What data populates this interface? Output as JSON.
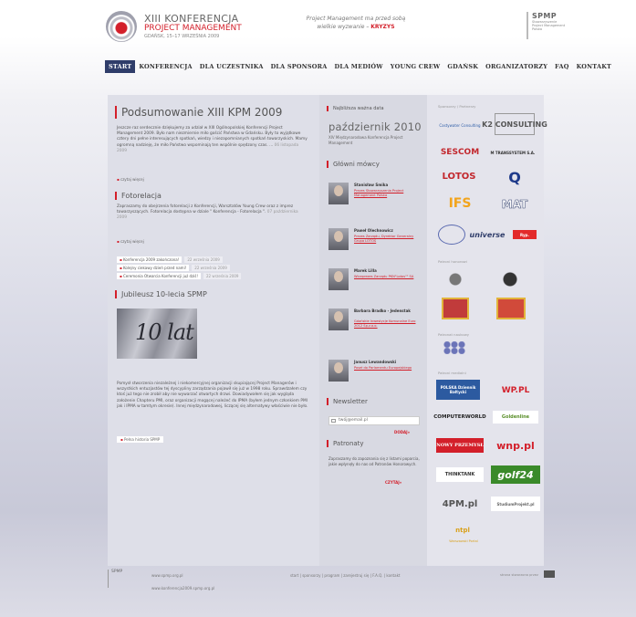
{
  "header": {
    "logo_line1": "XIII KONFERENCJA",
    "logo_line2": "PROJECT MANAGEMENT",
    "logo_line3": "GDAŃSK, 15–17 WRZEŚNIA 2009",
    "tagline_1": "Project Management ma przed sobą",
    "tagline_2": "wielkie wyzwanie –",
    "tagline_hl": "KRYZYS",
    "spmp_title": "SPMP",
    "spmp_sub": "Stowarzyszenie Project Management Polska"
  },
  "nav": {
    "items": [
      "START",
      "KONFERENCJA",
      "DLA UCZESTNIKA",
      "DLA SPONSORA",
      "DLA MEDIÓW",
      "YOUNG CREW",
      "GDAŃSK",
      "ORGANIZATORZY",
      "FAQ",
      "KONTAKT"
    ]
  },
  "main": {
    "title": "Podsumowanie XIII KPM 2009",
    "intro": "Jeszcze raz serdecznie dziękujemy za udział w XIII Ogólnopolskiej Konferencji Project Management 2009. Było nam niezmiernie miło gościć Państwa w Gdańsku. Były to wyjątkowe cztery dni pełne interesujących spotkań, wiedzy i niezapomnianych spotkań towarzyskich. Mamy ogromną nadzieję, że miło Państwo wspominają ten wspólnie spędzony czas. ...",
    "intro_date": "06 listopada 2009",
    "more_1": "czytaj więcej",
    "gallery_title": "Fotorelacja",
    "gallery_text": "Zapraszamy do obejrzenia fotorelacji z Konferencji, Warsztatów Young Crew oraz z imprez towarzyszących. Fotorelacja dostępna w dziale \" Konferencja - Fotorelacja \".",
    "gallery_date": "07 października 2009",
    "more_2": "czytaj więcej",
    "news": [
      {
        "label": "Konferencja 2009 zakończona!",
        "date": "22 września 2009"
      },
      {
        "label": "Kolejny ciekawy dzień przed nami!",
        "date": "22 września 2009"
      },
      {
        "label": "Ceremonia Otwarcia Konferencji już dziś!",
        "date": "22 września 2009"
      }
    ],
    "jubilee_title": "Jubileusz 10-lecia SPMP",
    "jubilee_photo_text": "10 lat",
    "jubilee_text": "Pomysł stworzenia niezależnej i niekomercyjnej organizacji skupiającej Project Managerów i wszystkich entuzjastów tej dyscypliny zarządzania pojawił się już w 1998 roku. Sprawdzałem czy ktoś już tego nie zrobił aby nie wywarzać otwartych drzwi. Dowiadywałem się jak wygląda założenie Chapteru PMI, oraz organizacji mogącej należeć do IPMA (byłem jednym członkiem PMI jak i IPMA w tamtym okresie). Innej międzynarodowej, liczącej się alternatywy właściwie nie było.",
    "jubilee_more": "Pełna historia SPMP"
  },
  "middle": {
    "next_label": "Najbliższa ważna data",
    "next_date": "październik 2010",
    "next_sub": "XIV Międzynarodowa Konferencja Project Management",
    "speakers_title": "Główni mówcy",
    "speakers": [
      {
        "name": "Stanisław Smika",
        "role": "Prezes Stowarzyszenia Project Management Polska"
      },
      {
        "name": "Paweł Olechnowicz",
        "role": "Prezes Zarządu, Dyrektor Generalny Grupa LOTOS"
      },
      {
        "name": "Marek Lilla",
        "role": "Wiceprezes Zarządu PKN\"Lotos\"\" SA"
      },
      {
        "name": "Barbara Bradko - Jedenstak",
        "role": "Gdańskie Inwestycje Komunalne Euro 2012 Sp.z.o.o."
      },
      {
        "name": "Janusz Lewandowski",
        "role": "Poseł do Parlamentu Europejskiego"
      }
    ],
    "newsletter_title": "Newsletter",
    "newsletter_placeholder": "twój@email.pl",
    "newsletter_button": "DODAJ»",
    "patrons_title": "Patronaty",
    "patrons_text": "Zapraszamy do zapoznania się z listami poparcia, jakie wpłynęły do nas od Patronów Honorowych.",
    "patrons_button": "CZYTAJ»"
  },
  "sponsors": {
    "sec_sponsors": "Sponsorzy / Partnerzy",
    "sec_honor": "Patroni honorowi",
    "sec_science": "Patronat naukowy",
    "sec_media": "Patroni medialni",
    "logos": [
      "Castywater Consulting",
      "K2 CONSULTING",
      "SESCOM",
      "M TRANSSYSTEM S.A.",
      "LOTOS",
      "Q",
      "IFS",
      "MAT",
      "universe",
      "Ryp.",
      "POLSKA Dziennik Bałtycki",
      "WP.PL",
      "COMPUTERWORLD",
      "Goldenline",
      "NOWY PRZEMYSŁ",
      "wnp.pl",
      "THINKTANK",
      "golf24",
      "4PM.pl",
      "StudiumProjekt.pl",
      "ntpl",
      "Warszawski Portal"
    ]
  },
  "footer": {
    "spmp": "SPMP",
    "www": "www.spmp.org.pl",
    "email": "www.konferencja2009.spmp.org.pl",
    "links": "start | sponsorzy | program | zarejestruj się | F.A.Q. | kontakt",
    "credit": "strona stworzona przez"
  },
  "colors": {
    "accent": "#d31f2a",
    "nav_active": "#2f3d6a",
    "panel": "#dedfe8"
  }
}
